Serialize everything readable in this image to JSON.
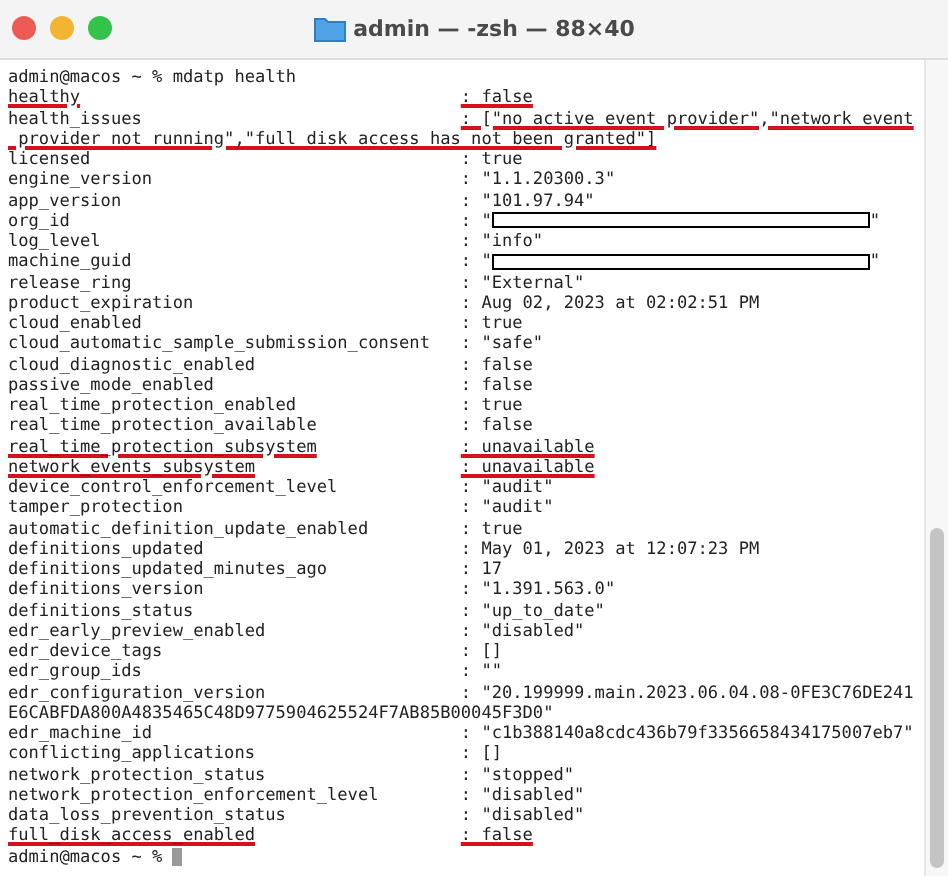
{
  "window": {
    "title": "admin — -zsh — 88×40"
  },
  "command": "admin@macos ~ % mdatp health",
  "rows": [
    {
      "key": "healthy",
      "value": ": false",
      "underline_key": true,
      "underline_value": true
    },
    {
      "key": "health_issues",
      "value": ": [\"no active event provider\",\"network event",
      "continuation": " provider not running\",\"full disk access has not been granted\"]",
      "underline_key": false,
      "underline_value": true
    },
    {
      "key": "licensed",
      "value": ": true",
      "underline_key": false,
      "underline_value": false
    },
    {
      "key": "engine_version",
      "value": ": \"1.1.20300.3\"",
      "underline_key": false,
      "underline_value": false
    },
    {
      "key": "app_version",
      "value": ": \"101.97.94\"",
      "underline_key": false,
      "underline_value": false
    },
    {
      "key": "org_id",
      "value": ": \"",
      "redacted": true,
      "value_end": "\"",
      "underline_key": false,
      "underline_value": false
    },
    {
      "key": "log_level",
      "value": ": \"info\"",
      "underline_key": false,
      "underline_value": false
    },
    {
      "key": "machine_guid",
      "value": ": \"",
      "redacted": true,
      "value_end": "\"",
      "underline_key": false,
      "underline_value": false
    },
    {
      "key": "release_ring",
      "value": ": \"External\"",
      "underline_key": false,
      "underline_value": false
    },
    {
      "key": "product_expiration",
      "value": ": Aug 02, 2023 at 02:02:51 PM",
      "underline_key": false,
      "underline_value": false
    },
    {
      "key": "cloud_enabled",
      "value": ": true",
      "underline_key": false,
      "underline_value": false
    },
    {
      "key": "cloud_automatic_sample_submission_consent",
      "value": ": \"safe\"",
      "underline_key": false,
      "underline_value": false
    },
    {
      "key": "cloud_diagnostic_enabled",
      "value": ": false",
      "underline_key": false,
      "underline_value": false
    },
    {
      "key": "passive_mode_enabled",
      "value": ": false",
      "underline_key": false,
      "underline_value": false
    },
    {
      "key": "real_time_protection_enabled",
      "value": ": true",
      "underline_key": false,
      "underline_value": false
    },
    {
      "key": "real_time_protection_available",
      "value": ": false",
      "underline_key": false,
      "underline_value": false
    },
    {
      "key": "real_time_protection_subsystem",
      "value": ": unavailable",
      "underline_key": true,
      "underline_value": true
    },
    {
      "key": "network_events_subsystem",
      "value": ": unavailable",
      "underline_key": true,
      "underline_value": true
    },
    {
      "key": "device_control_enforcement_level",
      "value": ": \"audit\"",
      "underline_key": false,
      "underline_value": false
    },
    {
      "key": "tamper_protection",
      "value": ": \"audit\"",
      "underline_key": false,
      "underline_value": false
    },
    {
      "key": "automatic_definition_update_enabled",
      "value": ": true",
      "underline_key": false,
      "underline_value": false
    },
    {
      "key": "definitions_updated",
      "value": ": May 01, 2023 at 12:07:23 PM",
      "underline_key": false,
      "underline_value": false
    },
    {
      "key": "definitions_updated_minutes_ago",
      "value": ": 17",
      "underline_key": false,
      "underline_value": false
    },
    {
      "key": "definitions_version",
      "value": ": \"1.391.563.0\"",
      "underline_key": false,
      "underline_value": false
    },
    {
      "key": "definitions_status",
      "value": ": \"up_to_date\"",
      "underline_key": false,
      "underline_value": false
    },
    {
      "key": "edr_early_preview_enabled",
      "value": ": \"disabled\"",
      "underline_key": false,
      "underline_value": false
    },
    {
      "key": "edr_device_tags",
      "value": ": []",
      "underline_key": false,
      "underline_value": false
    },
    {
      "key": "edr_group_ids",
      "value": ": \"\"",
      "underline_key": false,
      "underline_value": false
    },
    {
      "key": "edr_configuration_version",
      "value": ": \"20.199999.main.2023.06.04.08-0FE3C76DE241",
      "continuation": "E6CABFDA800A4835465C48D9775904625524F7AB85B00045F3D0\"",
      "underline_key": false,
      "underline_value": false
    },
    {
      "key": "edr_machine_id",
      "value": ": \"c1b388140a8cdc436b79f3356658434175007eb7\"",
      "underline_key": false,
      "underline_value": false
    },
    {
      "key": "conflicting_applications",
      "value": ": []",
      "underline_key": false,
      "underline_value": false
    },
    {
      "key": "network_protection_status",
      "value": ": \"stopped\"",
      "underline_key": false,
      "underline_value": false
    },
    {
      "key": "network_protection_enforcement_level",
      "value": ": \"disabled\"",
      "underline_key": false,
      "underline_value": false
    },
    {
      "key": "data_loss_prevention_status",
      "value": ": \"disabled\"",
      "underline_key": false,
      "underline_value": false
    },
    {
      "key": "full_disk_access_enabled",
      "value": ": false",
      "underline_key": true,
      "underline_value": true
    }
  ],
  "prompt": "admin@macos ~ %"
}
